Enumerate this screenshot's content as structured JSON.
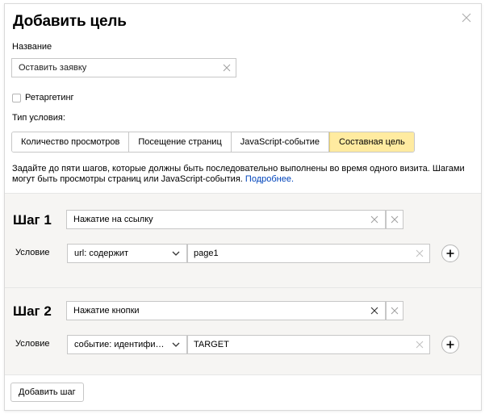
{
  "dialog": {
    "title": "Добавить цель",
    "close_icon": "close-icon"
  },
  "name_field": {
    "label": "Название",
    "value": "Оставить заявку"
  },
  "retargeting": {
    "label": "Ретаргетинг",
    "checked": false
  },
  "condition_type": {
    "label": "Тип условия:",
    "options": [
      "Количество просмотров",
      "Посещение страниц",
      "JavaScript-событие",
      "Составная цель"
    ],
    "selected": "Составная цель"
  },
  "description": {
    "text": "Задайте до пяти шагов, которые должны быть последовательно выполнены во время одного визита. Шагами могут быть просмотры страниц или JavaScript-события.",
    "link": "Подробнее."
  },
  "steps": [
    {
      "title": "Шаг 1",
      "name": "Нажатие на ссылку",
      "condition_label": "Условие",
      "condition_type": "url: содержит",
      "condition_value": "page1"
    },
    {
      "title": "Шаг 2",
      "name": "Нажатие кнопки",
      "condition_label": "Условие",
      "condition_type": "событие: идентифи…",
      "condition_value": "TARGET"
    }
  ],
  "add_step_button": "Добавить шаг",
  "colors": {
    "active_segment": "#ffeba0",
    "steps_background": "#f6f5f3",
    "link": "#0044bb"
  }
}
